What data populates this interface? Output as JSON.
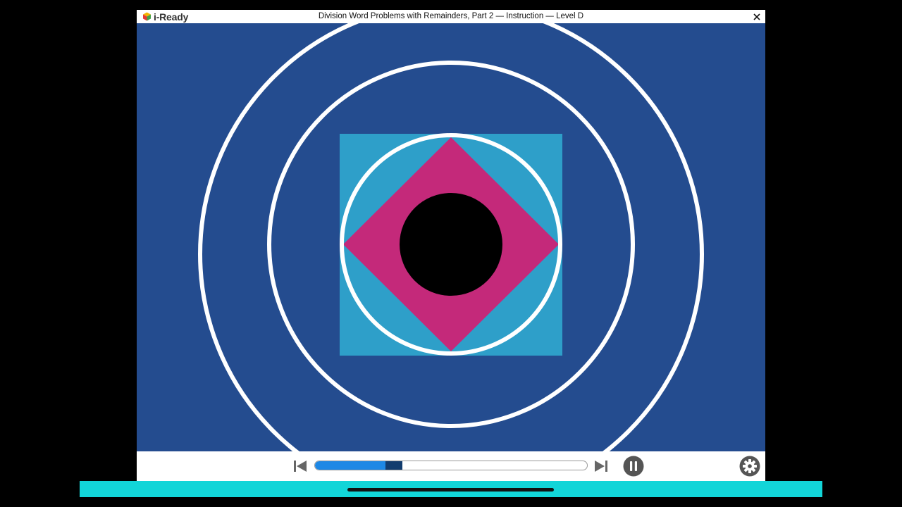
{
  "app": {
    "logo_text": "i-Ready",
    "title": "Division Word Problems with Remainders, Part 2 — Instruction — Level D"
  },
  "icons": {
    "logo": "i-ready-cube-icon",
    "close": "close-icon",
    "prev": "skip-previous-icon",
    "next": "skip-next-icon",
    "pause": "pause-icon",
    "settings": "gear-icon"
  },
  "player": {
    "progress": 0.26,
    "buffered_segment": [
      0.26,
      0.32
    ]
  },
  "colors": {
    "stage_background": "#244c8f",
    "square": "#2e9fc9",
    "diamond": "#c4297a",
    "rings": "#ffffff",
    "center_circle": "#000000",
    "progress_fill": "#1e88e5",
    "bottom_bar": "#12d5d8"
  }
}
